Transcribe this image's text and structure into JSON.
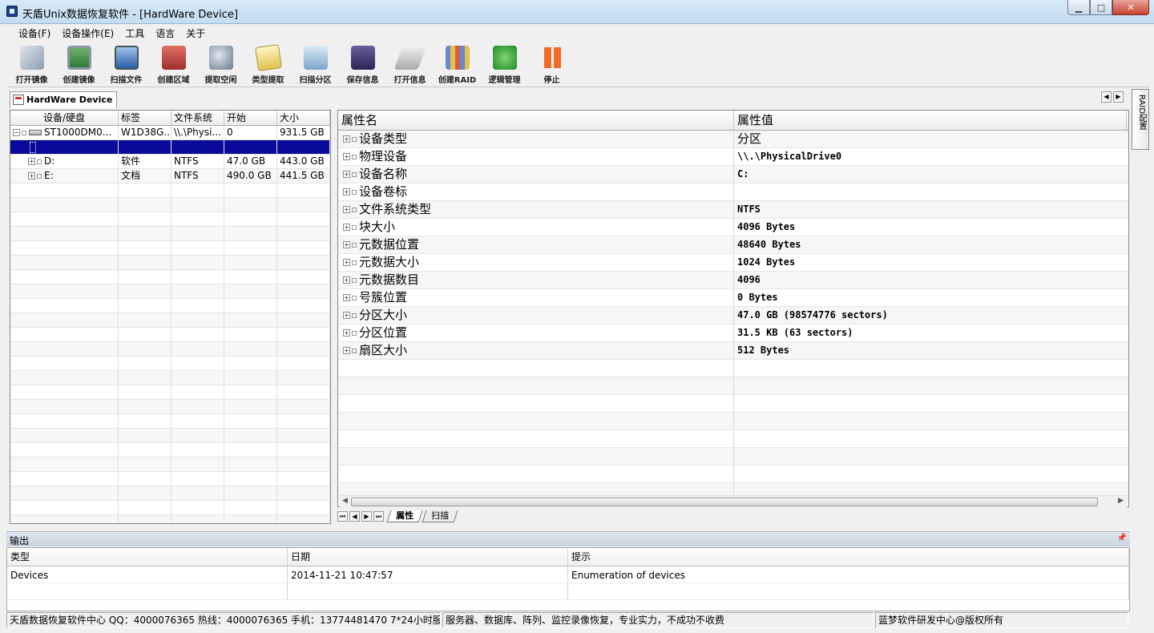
{
  "window": {
    "title": "天盾Unix数据恢复软件 - [HardWare Device]"
  },
  "menu": [
    "设备(F)",
    "设备操作(E)",
    "工具",
    "语言",
    "关于"
  ],
  "toolbar": [
    {
      "label": "打开镜像",
      "icon": "disk-open-icon"
    },
    {
      "label": "创建镜像",
      "icon": "monitor-image-icon"
    },
    {
      "label": "扫描文件",
      "icon": "scan-file-icon"
    },
    {
      "label": "创建区域",
      "icon": "create-area-icon"
    },
    {
      "label": "提取空闲",
      "icon": "extract-free-icon"
    },
    {
      "label": "类型提取",
      "icon": "type-extract-icon"
    },
    {
      "label": "扫描分区",
      "icon": "scan-partition-icon"
    },
    {
      "label": "保存信息",
      "icon": "save-info-icon"
    },
    {
      "label": "打开信息",
      "icon": "open-info-icon"
    },
    {
      "label": "创建RAID",
      "icon": "create-raid-icon"
    },
    {
      "label": "逻辑管理",
      "icon": "logic-manage-icon"
    },
    {
      "label": "停止",
      "icon": "stop-icon"
    }
  ],
  "device_tab": {
    "label": "HardWare Device"
  },
  "raid_side_tab": "RAID配置",
  "device_grid": {
    "headers": [
      "设备/硬盘",
      "标签",
      "文件系统",
      "开始",
      "大小"
    ],
    "rows": [
      {
        "device": "ST1000DM0...",
        "label": "W1D38G...",
        "fs": "\\\\.\\Physi...",
        "start": "0",
        "size": "931.5 GB"
      },
      {
        "device": "",
        "label": "",
        "fs": "",
        "start": "",
        "size": ""
      },
      {
        "device": "D:",
        "label": "软件",
        "fs": "NTFS",
        "start": "47.0 GB",
        "size": "443.0 GB"
      },
      {
        "device": "E:",
        "label": "文档",
        "fs": "NTFS",
        "start": "490.0 GB",
        "size": "441.5 GB"
      }
    ]
  },
  "properties": {
    "headers": [
      "属性名",
      "属性值"
    ],
    "rows": [
      {
        "name": "设备类型",
        "value": "分区"
      },
      {
        "name": "物理设备",
        "value": "\\\\.\\PhysicalDrive0"
      },
      {
        "name": "设备名称",
        "value": "C:"
      },
      {
        "name": "设备卷标",
        "value": ""
      },
      {
        "name": "文件系统类型",
        "value": "NTFS"
      },
      {
        "name": "块大小",
        "value": "4096 Bytes"
      },
      {
        "name": "元数据位置",
        "value": "48640 Bytes"
      },
      {
        "name": "元数据大小",
        "value": "1024 Bytes"
      },
      {
        "name": "元数据数目",
        "value": "4096"
      },
      {
        "name": "号簇位置",
        "value": "0 Bytes"
      },
      {
        "name": "分区大小",
        "value": "47.0 GB (98574776 sectors)"
      },
      {
        "name": "分区位置",
        "value": "31.5 KB (63 sectors)"
      },
      {
        "name": "扇区大小",
        "value": "512 Bytes"
      }
    ]
  },
  "bottom_tabs": [
    "属性",
    "扫描"
  ],
  "output": {
    "title": "输出",
    "headers": [
      "类型",
      "日期",
      "提示"
    ],
    "rows": [
      {
        "type": "Devices",
        "date": "2014-11-21 10:47:57",
        "tip": "Enumeration of devices"
      }
    ]
  },
  "status": [
    "天盾数据恢复软件中心 QQ：4000076365 热线：4000076365 手机：13774481470   7*24小时服务",
    "服务器、数据库、阵列、监控录像恢复，专业实力，不成功不收费",
    "蓝梦软件研发中心@版权所有"
  ]
}
